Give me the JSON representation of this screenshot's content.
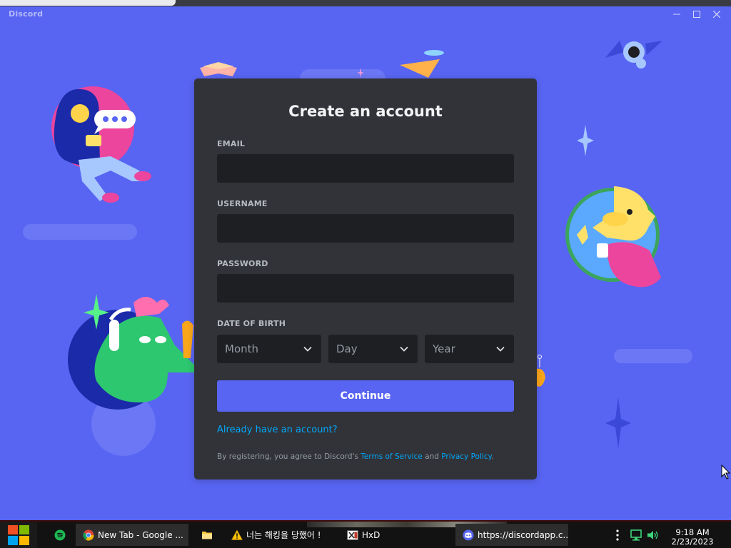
{
  "window": {
    "app_name": "Discord",
    "controls": {
      "minimize": "—",
      "maximize": "☐",
      "close": "✕"
    }
  },
  "auth": {
    "title": "Create an account",
    "fields": {
      "email": {
        "label": "EMAIL",
        "value": ""
      },
      "username": {
        "label": "USERNAME",
        "value": ""
      },
      "password": {
        "label": "PASSWORD",
        "value": ""
      }
    },
    "dob": {
      "label": "DATE OF BIRTH",
      "month": "Month",
      "day": "Day",
      "year": "Year"
    },
    "continue_label": "Continue",
    "login_link": "Already have an account?",
    "legal": {
      "prefix": "By registering, you agree to Discord's ",
      "terms": "Terms of Service",
      "and": " and ",
      "privacy": "Privacy Policy",
      "suffix": "."
    }
  },
  "colors": {
    "blurple": "#5865f2",
    "card": "#313338",
    "input": "#1e1f22",
    "link": "#00a8fc"
  },
  "taskbar": {
    "items": [
      {
        "label": "",
        "icon": "spotify-icon"
      },
      {
        "label": "New Tab - Google ...",
        "icon": "chrome-icon"
      },
      {
        "label": "",
        "icon": "file-explorer-icon"
      },
      {
        "label": "너는 해킹을 당했어 !",
        "icon": "warning-icon"
      },
      {
        "label": "HxD",
        "icon": "hxd-icon"
      },
      {
        "label": "https://discordapp.c...",
        "icon": "discord-icon"
      }
    ],
    "clock": {
      "time": "9:18 AM",
      "date": "2/23/2023"
    }
  }
}
